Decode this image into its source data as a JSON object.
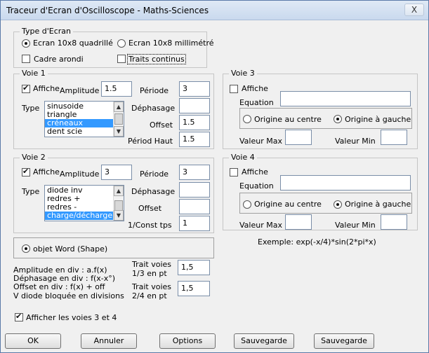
{
  "window": {
    "title": "Traceur d'Ecran d'Oscilloscope - Maths-Sciences",
    "close": "X"
  },
  "type_ecran": {
    "legend": "Type d'Ecran",
    "opt1": "Ecran 10x8 quadrillé",
    "opt2": "Ecran 10x8 millimétré",
    "cadre": "Cadre arondi",
    "traits": "Traits continus"
  },
  "voie1": {
    "legend": "Voie 1",
    "affiche": "Affiche",
    "amplitude_label": "Amplitude",
    "amplitude": "1.5",
    "periode_label": "Période",
    "periode": "3",
    "type_label": "Type",
    "types": [
      "sinusoide",
      "triangle",
      "créneaux",
      "dent scie"
    ],
    "selected_type": "créneaux",
    "dephasage_label": "Déphasage",
    "dephasage": "",
    "offset_label": "Offset",
    "offset": "1.5",
    "periodhaut_label": "Périod Haut",
    "periodhaut": "1.5"
  },
  "voie2": {
    "legend": "Voie 2",
    "affiche": "Affiche",
    "amplitude_label": "Amplitude",
    "amplitude": "3",
    "periode_label": "Période",
    "periode": "3",
    "type_label": "Type",
    "types": [
      "diode inv",
      "redres +",
      "redres -",
      "charge/décharge"
    ],
    "selected_type": "charge/décharge",
    "dephasage_label": "Déphasage",
    "dephasage": "",
    "offset_label": "Offset",
    "offset": "",
    "const_label": "1/Const tps",
    "const": "1"
  },
  "voie3": {
    "legend": "Voie 3",
    "affiche": "Affiche",
    "equation_label": "Equation",
    "equation": "",
    "origine_centre": "Origine au centre",
    "origine_gauche": "Origine à gauche",
    "valmax_label": "Valeur Max",
    "valmax": "",
    "valmin_label": "Valeur Min",
    "valmin": ""
  },
  "voie4": {
    "legend": "Voie 4",
    "affiche": "Affiche",
    "equation_label": "Equation",
    "equation": "",
    "origine_centre": "Origine au centre",
    "origine_gauche": "Origine à gauche",
    "valmax_label": "Valeur Max",
    "valmax": "",
    "valmin_label": "Valeur Min",
    "valmin": ""
  },
  "exemple": "Exemple: exp(-x/4)*sin(2*pi*x)",
  "objet_word": "objet Word (Shape)",
  "notes": [
    "Amplitude en div   : a.f(x)",
    "Déphasage en div : f(x-x°)",
    "Offset en div : f(x) + off",
    "V diode bloquée en divisions"
  ],
  "trait13": {
    "label1": "Trait voies",
    "label2": "1/3 en pt",
    "value": "1,5"
  },
  "trait24": {
    "label1": "Trait voies",
    "label2": "2/4 en pt",
    "value": "1,5"
  },
  "afficher34": "Afficher les voies 3 et 4",
  "buttons": {
    "ok": "OK",
    "annuler": "Annuler",
    "options": "Options",
    "sauvegarde1": "Sauvegarde",
    "sauvegarde2": "Sauvegarde"
  }
}
